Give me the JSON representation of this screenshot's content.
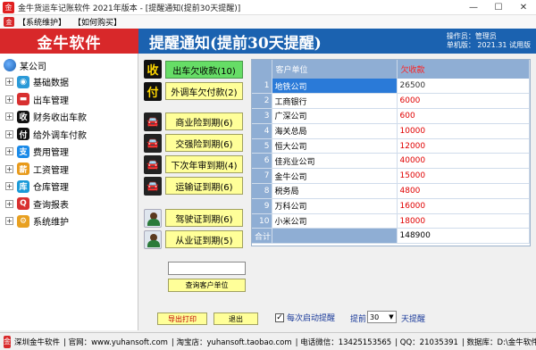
{
  "window": {
    "title": "金牛货运车记账软件 2021年版本 - [提醒通知(提前30天提醒)]",
    "minimize": "—",
    "maximize": "☐",
    "close": "✕"
  },
  "menu": {
    "items": [
      "【系统维护】",
      "【如何购买】"
    ]
  },
  "header": {
    "logo": "金牛软件",
    "title": "提醒通知(提前30天提醒)",
    "operator_line": "操作员：管理员",
    "version_line": "单机版： 2021.31 试用版"
  },
  "tree": {
    "root": "某公司",
    "items": [
      {
        "label": "基础数据",
        "icon": "database-icon",
        "color": "#2a9ad8",
        "glyph": "◉"
      },
      {
        "label": "出车管理",
        "icon": "truck-icon",
        "color": "#d83030",
        "glyph": "▬"
      },
      {
        "label": "财务收出车款",
        "icon": "receive-icon",
        "color": "#111111",
        "glyph": "收"
      },
      {
        "label": "给外调车付款",
        "icon": "pay-icon",
        "color": "#111111",
        "glyph": "付"
      },
      {
        "label": "费用管理",
        "icon": "expense-icon",
        "color": "#1a8ae8",
        "glyph": "支"
      },
      {
        "label": "工资管理",
        "icon": "salary-icon",
        "color": "#e89a1a",
        "glyph": "薪"
      },
      {
        "label": "仓库管理",
        "icon": "warehouse-icon",
        "color": "#1a9ad8",
        "glyph": "库"
      },
      {
        "label": "查询报表",
        "icon": "report-icon",
        "color": "#d83030",
        "glyph": "Q"
      },
      {
        "label": "系统维护",
        "icon": "settings-icon",
        "color": "#e8a020",
        "glyph": "⚙"
      }
    ]
  },
  "side_icons": {
    "receive": "收",
    "pay": "付"
  },
  "reminders": {
    "buttons": [
      "出车欠收款(10)",
      "外调车欠付款(2)",
      "商业险到期(6)",
      "交强险到期(6)",
      "下次年审到期(4)",
      "运输证到期(6)",
      "驾驶证到期(6)",
      "从业证到期(5)"
    ],
    "query_button": "查询客户单位",
    "search_value": ""
  },
  "table": {
    "columns": [
      "客户单位",
      "欠收款"
    ],
    "rows": [
      {
        "num": "1",
        "company": "地铁公司",
        "amount": "26500"
      },
      {
        "num": "2",
        "company": "工商银行",
        "amount": "6000"
      },
      {
        "num": "3",
        "company": "广深公司",
        "amount": "600"
      },
      {
        "num": "4",
        "company": "海关总局",
        "amount": "10000"
      },
      {
        "num": "5",
        "company": "恒大公司",
        "amount": "12000"
      },
      {
        "num": "6",
        "company": "佳兆业公司",
        "amount": "40000"
      },
      {
        "num": "7",
        "company": "金牛公司",
        "amount": "15000"
      },
      {
        "num": "8",
        "company": "税务局",
        "amount": "4800"
      },
      {
        "num": "9",
        "company": "万科公司",
        "amount": "16000"
      },
      {
        "num": "10",
        "company": "小米公司",
        "amount": "18000"
      }
    ],
    "total_label": "合计",
    "total_value": "148900"
  },
  "bottom": {
    "export_label": "导出打印",
    "exit_label": "退出",
    "startup_checkbox_label": "每次启动提醒",
    "startup_checked": "✓",
    "advance_label": "提前",
    "days_value": "30",
    "days_unit": "天提醒"
  },
  "status": {
    "segments": [
      "深圳金牛软件",
      "| 官网：www.yuhansoft.com",
      "| 淘宝店：yuhansoft.taobao.com",
      "| 电话微信：13425153565",
      "| QQ：21035391",
      "| 数据库：D:\\金牛软件\\"
    ]
  }
}
